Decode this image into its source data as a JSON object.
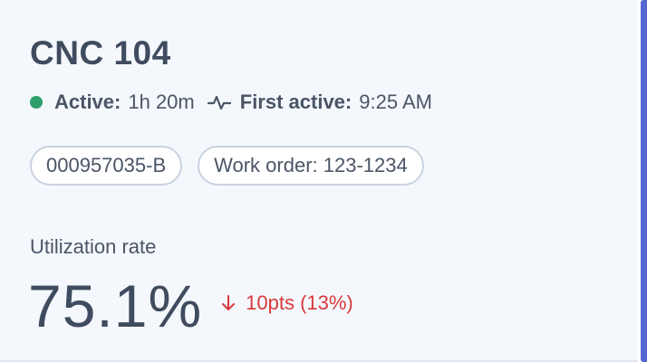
{
  "machine": {
    "name": "CNC 104"
  },
  "status": {
    "active_label": "Active:",
    "active_value": "1h 20m",
    "first_active_label": "First active:",
    "first_active_value": "9:25 AM",
    "dot_color": "#2e9e6b",
    "pulse_icon": "activity-pulse-icon"
  },
  "tags": [
    {
      "label": "000957035-B"
    },
    {
      "label": "Work order: 123-1234"
    }
  ],
  "metric": {
    "label": "Utilization rate",
    "value": "75.1%",
    "delta_text": "10pts (13%)",
    "delta_icon": "arrow-down-icon",
    "delta_color": "#d8383b"
  },
  "accent_color": "#5567d2"
}
